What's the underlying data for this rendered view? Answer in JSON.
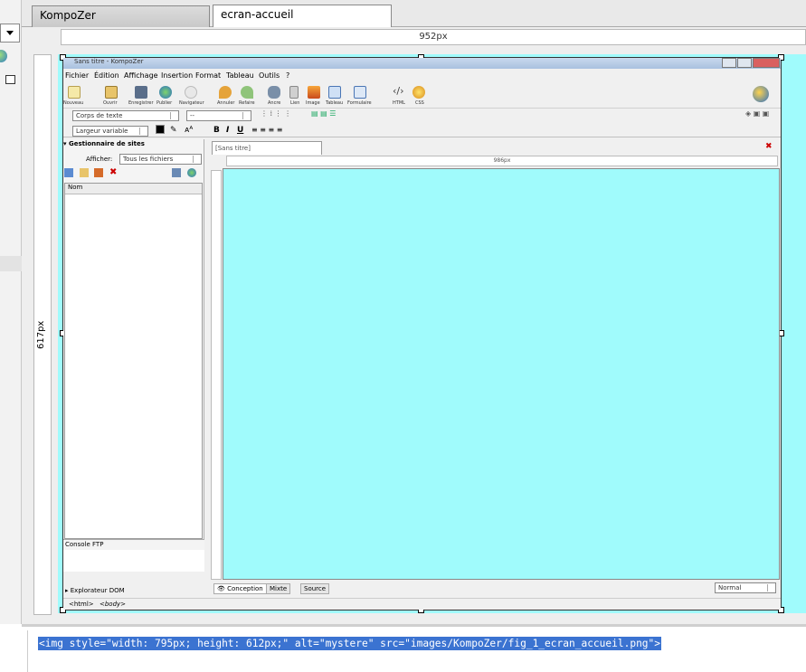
{
  "tabs": [
    {
      "label": "KompoZer",
      "active": false
    },
    {
      "label": "ecran-accueil",
      "active": true
    }
  ],
  "editor": {
    "ruler_width_label": "952px",
    "ruler_height_label": "617px",
    "image_background": "#a0fbfc"
  },
  "embedded_screenshot": {
    "title": "Sans titre - KompoZer",
    "menu": [
      "Fichier",
      "Édition",
      "Affichage",
      "Insertion",
      "Format",
      "Tableau",
      "Outils",
      "?"
    ],
    "toolbar": [
      "Nouveau",
      "Ouvrir",
      "Enregistrer",
      "Publier",
      "Navigateur",
      "Annuler",
      "Refaire",
      "Ancre",
      "Lien",
      "Image",
      "Tableau",
      "Formulaire",
      "HTML",
      "CSS"
    ],
    "paragraph_format": "Corps de texte",
    "font_select": "--",
    "width_select": "Largeur variable",
    "site_manager": "Gestionnaire de sites",
    "show_label": "Afficher:",
    "show_value": "Tous les fichiers",
    "name_column": "Nom",
    "ftp_console": "Console FTP",
    "dom_explorer": "Explorateur DOM",
    "doc_tab": "[Sans titre]",
    "inner_ruler_label": "986px",
    "view_tabs": [
      "Conception",
      "Mixte",
      "Source"
    ],
    "zoom": "Normal",
    "path": [
      "<html>",
      "<body>"
    ]
  },
  "source_code": "<img style=\"width: 795px; height: 612px;\" alt=\"mystere\" src=\"images/KompoZer/fig_1_ecran_accueil.png\">",
  "colors": {
    "selection": "#3b73d1",
    "canvas": "#a0fbfc"
  }
}
